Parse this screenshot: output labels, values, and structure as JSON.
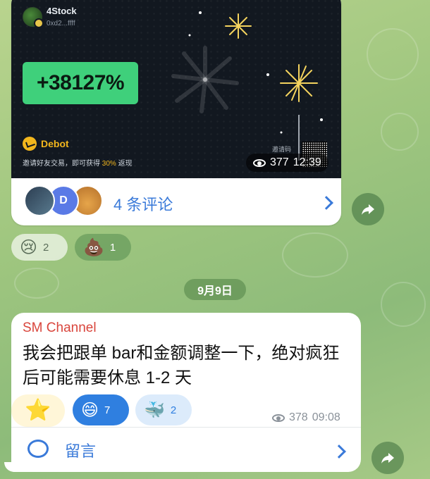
{
  "promo": {
    "account_name": "4Stock",
    "account_addr": "0xd2...ffff",
    "percent": "+38127%",
    "brand": "Debot",
    "invite_prefix": "邀请好友交易，即可获得",
    "invite_highlight": "30%",
    "invite_suffix": "返现",
    "qr_label": "邀请码",
    "views": "377",
    "time": "12:39"
  },
  "comments": {
    "avatar_initial": "D",
    "label": "4  条评论"
  },
  "reactions_top": [
    {
      "emoji": "😢",
      "count": "2"
    },
    {
      "emoji": "💩",
      "count": "1"
    }
  ],
  "date_label": "9月9日",
  "message": {
    "channel": "SM Channel",
    "text": "我会把跟单 bar和金额调整一下，绝对疯狂后可能需要休息 1-2 天",
    "reactions": [
      {
        "emoji": "⭐",
        "count": ""
      },
      {
        "emoji": "😄",
        "count": "7"
      },
      {
        "emoji": "🐳",
        "count": "2"
      }
    ],
    "views": "378",
    "time": "09:08",
    "comment_label": "留言"
  },
  "colors": {
    "accent_blue": "#3a7ad9",
    "channel_red": "#d9453c",
    "percent_green": "#3fd07b",
    "brand_yellow": "#f3b71d"
  },
  "icons": [
    "share-icon",
    "eye-icon",
    "chevron-right-icon",
    "comment-bubble-icon"
  ]
}
